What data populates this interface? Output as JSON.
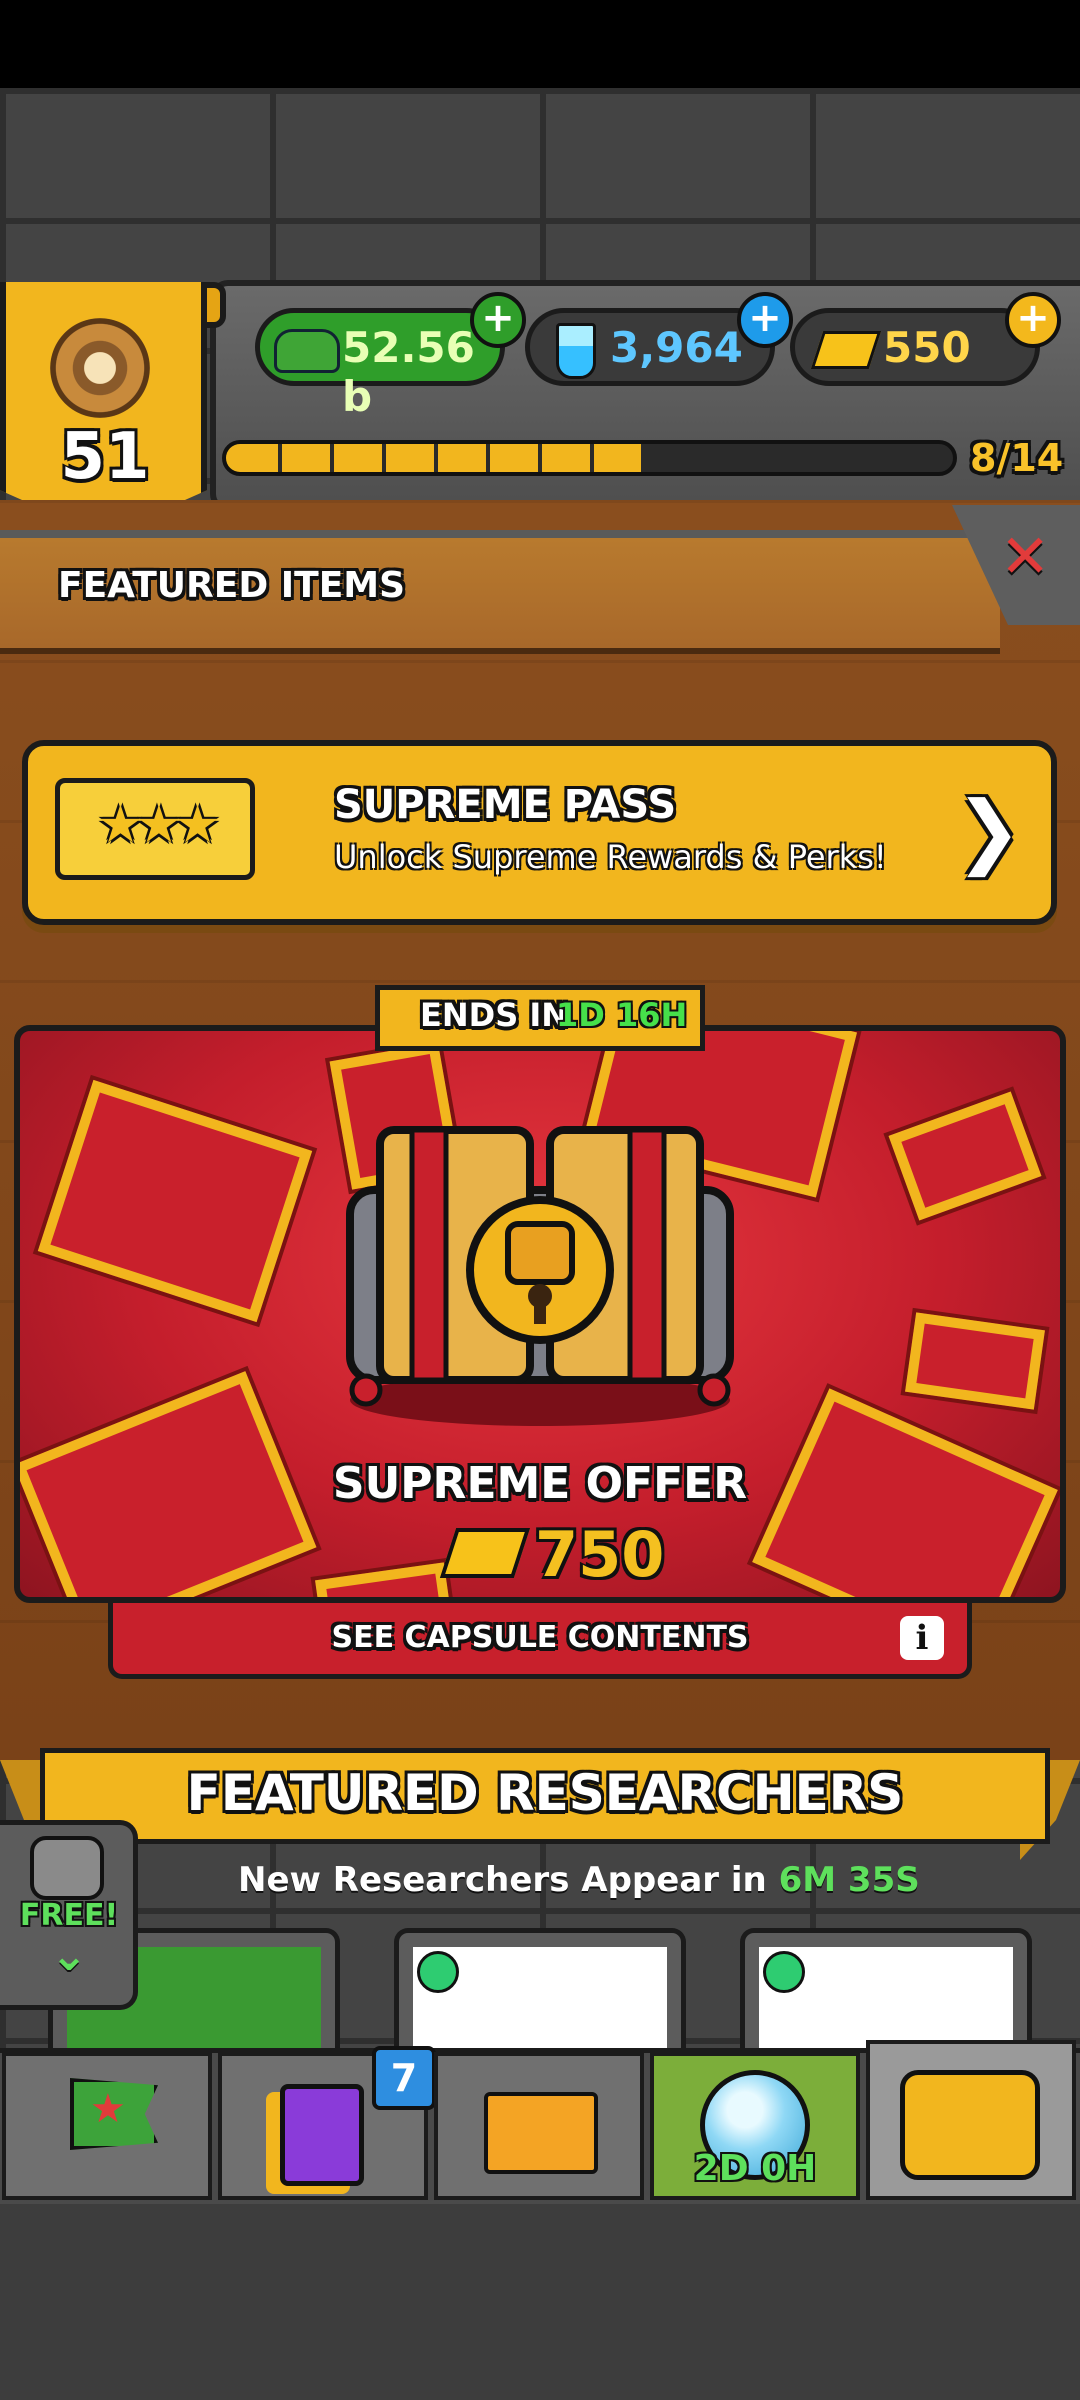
{
  "header": {
    "level": "51",
    "cash": "52.56 b",
    "science": "3,964",
    "gold": "550",
    "xp_progress_text": "8/14",
    "xp_filled_segments": 8,
    "xp_total_segments": 14
  },
  "featured": {
    "title": "FEATURED ITEMS",
    "close_label": "✕"
  },
  "pass": {
    "title": "SUPREME PASS",
    "subtitle": "Unlock Supreme Rewards & Perks!",
    "stars": "★★★",
    "chevron": "❯"
  },
  "offer": {
    "ends_label": "ENDS IN",
    "ends_time": "1D 16H",
    "title": "SUPREME OFFER",
    "price": "750",
    "see_contents": "SEE CAPSULE CONTENTS",
    "info": "i"
  },
  "researchers": {
    "title": "FEATURED RESEARCHERS",
    "subtitle_prefix": "New Researchers Appear in",
    "timer": "6M 35S",
    "free_label": "FREE!",
    "free_chevron": "⌄"
  },
  "nav": {
    "cards_badge": "7",
    "globe_timer": "2D 0H"
  },
  "colors": {
    "accent_gold": "#f2b61e",
    "offer_red": "#c41e2c",
    "timer_green": "#5ee05c"
  }
}
